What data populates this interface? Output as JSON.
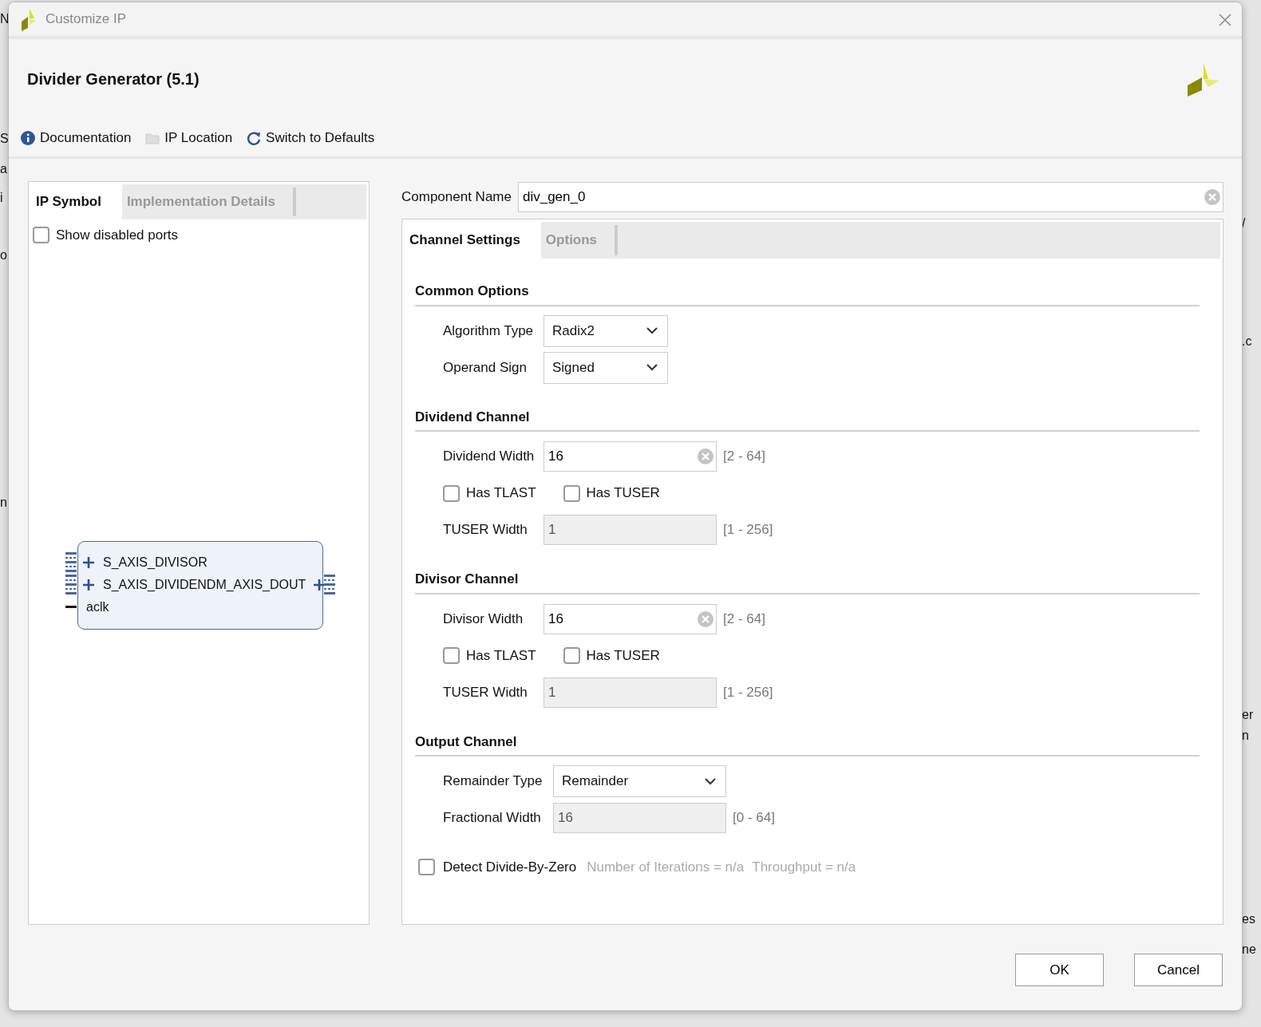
{
  "background": {
    "left_fragments": [
      "N",
      "S",
      "a",
      "i",
      "o",
      "n"
    ],
    "right_fragments": [
      "/",
      ".c",
      "er",
      "n",
      "es",
      "ne"
    ]
  },
  "window": {
    "title": "Customize IP"
  },
  "header": {
    "title": "Divider Generator (5.1)"
  },
  "toolbar": [
    {
      "label": "Documentation",
      "kind": "info"
    },
    {
      "label": "IP Location",
      "kind": "folder"
    },
    {
      "label": "Switch to Defaults",
      "kind": "refresh"
    }
  ],
  "left_panel": {
    "tabs": [
      {
        "label": "IP Symbol",
        "selected": true
      },
      {
        "label": "Implementation Details",
        "selected": false
      }
    ],
    "show_disabled_ports": {
      "label": "Show disabled ports",
      "checked": false
    },
    "symbol": {
      "left_ports": [
        {
          "name": "S_AXIS_DIVISOR",
          "kind": "bus"
        },
        {
          "name": "S_AXIS_DIVIDEND",
          "kind": "bus"
        },
        {
          "name": "aclk",
          "kind": "wire"
        }
      ],
      "right_ports": [
        {
          "name": "M_AXIS_DOUT",
          "kind": "bus"
        }
      ]
    }
  },
  "component_name": {
    "label": "Component Name",
    "value": "div_gen_0"
  },
  "config_tabs": [
    {
      "label": "Channel Settings",
      "selected": true
    },
    {
      "label": "Options",
      "selected": false
    }
  ],
  "sections": [
    {
      "title": "Common Options",
      "rows": [
        {
          "kind": "select",
          "label": "Algorithm Type",
          "value": "Radix2"
        },
        {
          "kind": "select",
          "label": "Operand Sign",
          "value": "Signed"
        }
      ]
    },
    {
      "title": "Dividend Channel",
      "rows": [
        {
          "kind": "input",
          "label": "Dividend Width",
          "value": "16",
          "range": "[2 - 64]",
          "disabled": false
        },
        {
          "kind": "checks",
          "items": [
            {
              "label": "Has TLAST",
              "checked": false
            },
            {
              "label": "Has TUSER",
              "checked": false
            }
          ]
        },
        {
          "kind": "input",
          "label": "TUSER Width",
          "value": "1",
          "range": "[1 - 256]",
          "disabled": true
        }
      ]
    },
    {
      "title": "Divisor Channel",
      "rows": [
        {
          "kind": "input",
          "label": "Divisor Width",
          "value": "16",
          "range": "[2 - 64]",
          "disabled": false
        },
        {
          "kind": "checks",
          "items": [
            {
              "label": "Has TLAST",
              "checked": false
            },
            {
              "label": "Has TUSER",
              "checked": false
            }
          ]
        },
        {
          "kind": "input",
          "label": "TUSER Width",
          "value": "1",
          "range": "[1 - 256]",
          "disabled": true
        }
      ]
    },
    {
      "title": "Output Channel",
      "rows": [
        {
          "kind": "select",
          "label": "Remainder Type",
          "value": "Remainder"
        },
        {
          "kind": "input",
          "label": "Fractional Width",
          "value": "16",
          "range": "[0 - 64]",
          "disabled": true
        }
      ]
    }
  ],
  "detect": {
    "label": "Detect Divide-By-Zero",
    "checked": false
  },
  "notes": [
    "Number of Iterations = n/a",
    "Throughput = n/a"
  ],
  "buttons": [
    "OK",
    "Cancel"
  ]
}
